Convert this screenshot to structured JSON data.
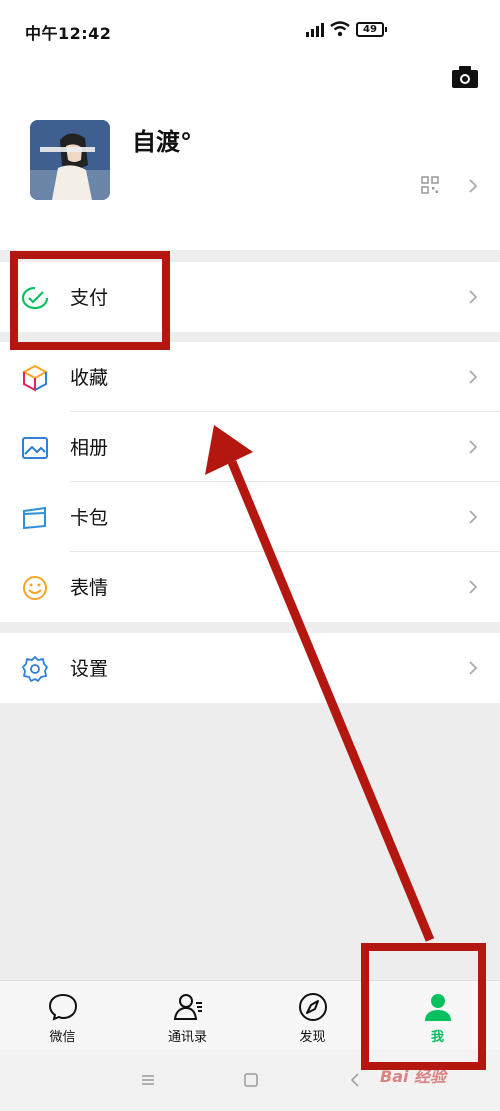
{
  "status_bar": {
    "time": "中午12:42",
    "battery": "49"
  },
  "profile": {
    "nickname": "自渡°"
  },
  "menu": {
    "pay": "支付",
    "favorites": "收藏",
    "album": "相册",
    "cards": "卡包",
    "stickers": "表情",
    "settings": "设置"
  },
  "tabs": [
    {
      "label": "微信",
      "icon": "chat-bubble-icon"
    },
    {
      "label": "通讯录",
      "icon": "contacts-icon"
    },
    {
      "label": "发现",
      "icon": "compass-icon"
    },
    {
      "label": "我",
      "icon": "person-icon"
    }
  ],
  "watermark": "Bai 经验",
  "colors": {
    "accent_green": "#07c160",
    "annotation_red": "#b3170f",
    "pay_icon": "#07c160",
    "album_icon": "#2f7ed8",
    "cards_icon": "#2f8fd8",
    "stickers_icon": "#f5a623",
    "settings_icon": "#2f7ed8"
  }
}
